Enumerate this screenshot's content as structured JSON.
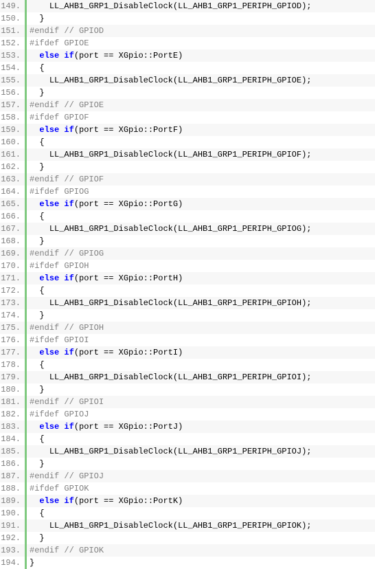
{
  "lines": [
    {
      "n": "149.",
      "indent": "    ",
      "tokens": [
        {
          "t": "",
          "c": "LL_AHB1_GRP1_DisableClock(LL_AHB1_GRP1_PERIPH_GPIOD);"
        }
      ]
    },
    {
      "n": "150.",
      "indent": "  ",
      "tokens": [
        {
          "t": "",
          "c": "}"
        }
      ]
    },
    {
      "n": "151.",
      "indent": "",
      "tokens": [
        {
          "t": "pp",
          "c": "#endif"
        },
        {
          "t": "cm",
          "c": " // GPIOD"
        }
      ]
    },
    {
      "n": "152.",
      "indent": "",
      "tokens": [
        {
          "t": "pp",
          "c": "#ifdef GPIOE"
        }
      ]
    },
    {
      "n": "153.",
      "indent": "  ",
      "tokens": [
        {
          "t": "kw",
          "c": "else"
        },
        {
          "t": "",
          "c": " "
        },
        {
          "t": "kw",
          "c": "if"
        },
        {
          "t": "",
          "c": "(port == XGpio::PortE)"
        }
      ]
    },
    {
      "n": "154.",
      "indent": "  ",
      "tokens": [
        {
          "t": "",
          "c": "{"
        }
      ]
    },
    {
      "n": "155.",
      "indent": "    ",
      "tokens": [
        {
          "t": "",
          "c": "LL_AHB1_GRP1_DisableClock(LL_AHB1_GRP1_PERIPH_GPIOE);"
        }
      ]
    },
    {
      "n": "156.",
      "indent": "  ",
      "tokens": [
        {
          "t": "",
          "c": "}"
        }
      ]
    },
    {
      "n": "157.",
      "indent": "",
      "tokens": [
        {
          "t": "pp",
          "c": "#endif"
        },
        {
          "t": "cm",
          "c": " // GPIOE"
        }
      ]
    },
    {
      "n": "158.",
      "indent": "",
      "tokens": [
        {
          "t": "pp",
          "c": "#ifdef GPIOF"
        }
      ]
    },
    {
      "n": "159.",
      "indent": "  ",
      "tokens": [
        {
          "t": "kw",
          "c": "else"
        },
        {
          "t": "",
          "c": " "
        },
        {
          "t": "kw",
          "c": "if"
        },
        {
          "t": "",
          "c": "(port == XGpio::PortF)"
        }
      ]
    },
    {
      "n": "160.",
      "indent": "  ",
      "tokens": [
        {
          "t": "",
          "c": "{"
        }
      ]
    },
    {
      "n": "161.",
      "indent": "    ",
      "tokens": [
        {
          "t": "",
          "c": "LL_AHB1_GRP1_DisableClock(LL_AHB1_GRP1_PERIPH_GPIOF);"
        }
      ]
    },
    {
      "n": "162.",
      "indent": "  ",
      "tokens": [
        {
          "t": "",
          "c": "}"
        }
      ]
    },
    {
      "n": "163.",
      "indent": "",
      "tokens": [
        {
          "t": "pp",
          "c": "#endif"
        },
        {
          "t": "cm",
          "c": " // GPIOF"
        }
      ]
    },
    {
      "n": "164.",
      "indent": "",
      "tokens": [
        {
          "t": "pp",
          "c": "#ifdef GPIOG"
        }
      ]
    },
    {
      "n": "165.",
      "indent": "  ",
      "tokens": [
        {
          "t": "kw",
          "c": "else"
        },
        {
          "t": "",
          "c": " "
        },
        {
          "t": "kw",
          "c": "if"
        },
        {
          "t": "",
          "c": "(port == XGpio::PortG)"
        }
      ]
    },
    {
      "n": "166.",
      "indent": "  ",
      "tokens": [
        {
          "t": "",
          "c": "{"
        }
      ]
    },
    {
      "n": "167.",
      "indent": "    ",
      "tokens": [
        {
          "t": "",
          "c": "LL_AHB1_GRP1_DisableClock(LL_AHB1_GRP1_PERIPH_GPIOG);"
        }
      ]
    },
    {
      "n": "168.",
      "indent": "  ",
      "tokens": [
        {
          "t": "",
          "c": "}"
        }
      ]
    },
    {
      "n": "169.",
      "indent": "",
      "tokens": [
        {
          "t": "pp",
          "c": "#endif"
        },
        {
          "t": "cm",
          "c": " // GPIOG"
        }
      ]
    },
    {
      "n": "170.",
      "indent": "",
      "tokens": [
        {
          "t": "pp",
          "c": "#ifdef GPIOH"
        }
      ]
    },
    {
      "n": "171.",
      "indent": "  ",
      "tokens": [
        {
          "t": "kw",
          "c": "else"
        },
        {
          "t": "",
          "c": " "
        },
        {
          "t": "kw",
          "c": "if"
        },
        {
          "t": "",
          "c": "(port == XGpio::PortH)"
        }
      ]
    },
    {
      "n": "172.",
      "indent": "  ",
      "tokens": [
        {
          "t": "",
          "c": "{"
        }
      ]
    },
    {
      "n": "173.",
      "indent": "    ",
      "tokens": [
        {
          "t": "",
          "c": "LL_AHB1_GRP1_DisableClock(LL_AHB1_GRP1_PERIPH_GPIOH);"
        }
      ]
    },
    {
      "n": "174.",
      "indent": "  ",
      "tokens": [
        {
          "t": "",
          "c": "}"
        }
      ]
    },
    {
      "n": "175.",
      "indent": "",
      "tokens": [
        {
          "t": "pp",
          "c": "#endif"
        },
        {
          "t": "cm",
          "c": " // GPIOH"
        }
      ]
    },
    {
      "n": "176.",
      "indent": "",
      "tokens": [
        {
          "t": "pp",
          "c": "#ifdef GPIOI"
        }
      ]
    },
    {
      "n": "177.",
      "indent": "  ",
      "tokens": [
        {
          "t": "kw",
          "c": "else"
        },
        {
          "t": "",
          "c": " "
        },
        {
          "t": "kw",
          "c": "if"
        },
        {
          "t": "",
          "c": "(port == XGpio::PortI)"
        }
      ]
    },
    {
      "n": "178.",
      "indent": "  ",
      "tokens": [
        {
          "t": "",
          "c": "{"
        }
      ]
    },
    {
      "n": "179.",
      "indent": "    ",
      "tokens": [
        {
          "t": "",
          "c": "LL_AHB1_GRP1_DisableClock(LL_AHB1_GRP1_PERIPH_GPIOI);"
        }
      ]
    },
    {
      "n": "180.",
      "indent": "  ",
      "tokens": [
        {
          "t": "",
          "c": "}"
        }
      ]
    },
    {
      "n": "181.",
      "indent": "",
      "tokens": [
        {
          "t": "pp",
          "c": "#endif"
        },
        {
          "t": "cm",
          "c": " // GPIOI"
        }
      ]
    },
    {
      "n": "182.",
      "indent": "",
      "tokens": [
        {
          "t": "pp",
          "c": "#ifdef GPIOJ"
        }
      ]
    },
    {
      "n": "183.",
      "indent": "  ",
      "tokens": [
        {
          "t": "kw",
          "c": "else"
        },
        {
          "t": "",
          "c": " "
        },
        {
          "t": "kw",
          "c": "if"
        },
        {
          "t": "",
          "c": "(port == XGpio::PortJ)"
        }
      ]
    },
    {
      "n": "184.",
      "indent": "  ",
      "tokens": [
        {
          "t": "",
          "c": "{"
        }
      ]
    },
    {
      "n": "185.",
      "indent": "    ",
      "tokens": [
        {
          "t": "",
          "c": "LL_AHB1_GRP1_DisableClock(LL_AHB1_GRP1_PERIPH_GPIOJ);"
        }
      ]
    },
    {
      "n": "186.",
      "indent": "  ",
      "tokens": [
        {
          "t": "",
          "c": "}"
        }
      ]
    },
    {
      "n": "187.",
      "indent": "",
      "tokens": [
        {
          "t": "pp",
          "c": "#endif"
        },
        {
          "t": "cm",
          "c": " // GPIOJ"
        }
      ]
    },
    {
      "n": "188.",
      "indent": "",
      "tokens": [
        {
          "t": "pp",
          "c": "#ifdef GPIOK"
        }
      ]
    },
    {
      "n": "189.",
      "indent": "  ",
      "tokens": [
        {
          "t": "kw",
          "c": "else"
        },
        {
          "t": "",
          "c": " "
        },
        {
          "t": "kw",
          "c": "if"
        },
        {
          "t": "",
          "c": "(port == XGpio::PortK)"
        }
      ]
    },
    {
      "n": "190.",
      "indent": "  ",
      "tokens": [
        {
          "t": "",
          "c": "{"
        }
      ]
    },
    {
      "n": "191.",
      "indent": "    ",
      "tokens": [
        {
          "t": "",
          "c": "LL_AHB1_GRP1_DisableClock(LL_AHB1_GRP1_PERIPH_GPIOK);"
        }
      ]
    },
    {
      "n": "192.",
      "indent": "  ",
      "tokens": [
        {
          "t": "",
          "c": "}"
        }
      ]
    },
    {
      "n": "193.",
      "indent": "",
      "tokens": [
        {
          "t": "pp",
          "c": "#endif"
        },
        {
          "t": "cm",
          "c": " // GPIOK"
        }
      ]
    },
    {
      "n": "194.",
      "indent": "",
      "tokens": [
        {
          "t": "",
          "c": "}"
        }
      ]
    }
  ]
}
